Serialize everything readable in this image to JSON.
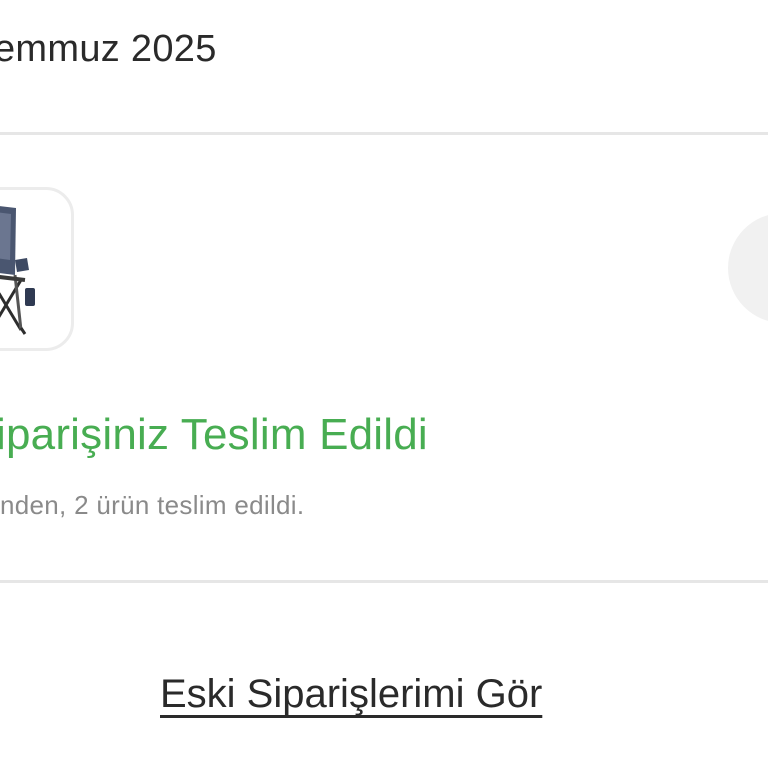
{
  "header": {
    "date_label": "emmuz 2025"
  },
  "order": {
    "product_image": "camping-chair-image",
    "status_title": "iparişiniz Teslim Edildi",
    "status_description": "nden, 2 ürün teslim edildi.",
    "status_color": "#48ad52"
  },
  "footer": {
    "old_orders_link": "Eski Siparişlerimi Gör"
  }
}
